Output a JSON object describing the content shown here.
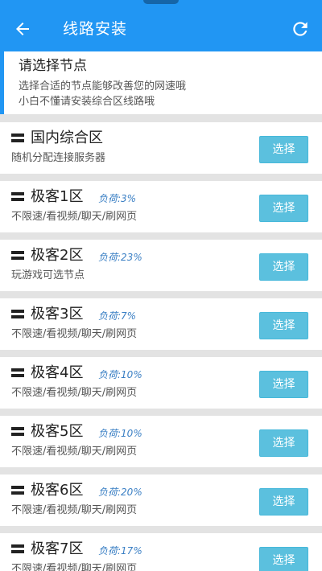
{
  "appbar": {
    "title": "线路安装"
  },
  "notice": {
    "title": "请选择节点",
    "line1": "选择合适的节点能够改善您的网速哦",
    "line2": "小白不懂请安装综合区线路哦"
  },
  "nodes": [
    {
      "name": "国内综合区",
      "load": "",
      "desc": "随机分配连接服务器",
      "button": "选择"
    },
    {
      "name": "极客1区",
      "load": "负荷:3%",
      "desc": "不限速/看视频/聊天/刷网页",
      "button": "选择"
    },
    {
      "name": "极客2区",
      "load": "负荷:23%",
      "desc": "玩游戏可选节点",
      "button": "选择"
    },
    {
      "name": "极客3区",
      "load": "负荷:7%",
      "desc": "不限速/看视频/聊天/刷网页",
      "button": "选择"
    },
    {
      "name": "极客4区",
      "load": "负荷:10%",
      "desc": "不限速/看视频/聊天/刷网页",
      "button": "选择"
    },
    {
      "name": "极客5区",
      "load": "负荷:10%",
      "desc": "不限速/看视频/聊天/刷网页",
      "button": "选择"
    },
    {
      "name": "极客6区",
      "load": "负荷:20%",
      "desc": "不限速/看视频/聊天/刷网页",
      "button": "选择"
    },
    {
      "name": "极客7区",
      "load": "负荷:17%",
      "desc": "不限速/看视频/聊天/刷网页",
      "button": "选择"
    }
  ],
  "colors": {
    "primary": "#2196f3",
    "button": "#5bc0de",
    "load_text": "#3a7fc4"
  },
  "icons": {
    "back": "arrow-left-icon",
    "refresh": "refresh-icon",
    "node": "menu-icon"
  }
}
